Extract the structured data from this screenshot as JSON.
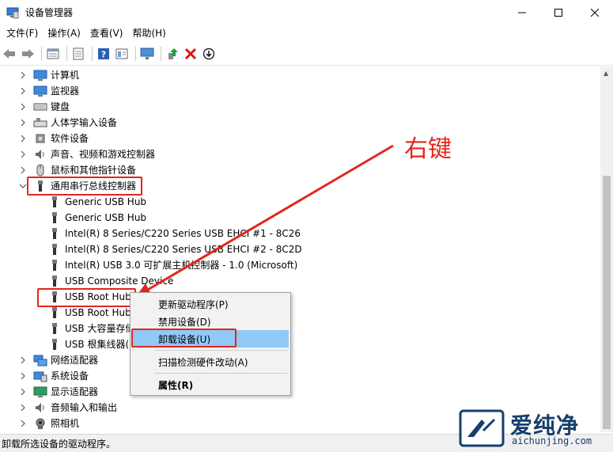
{
  "window": {
    "title": "设备管理器",
    "controls": [
      "minimize",
      "maximize",
      "close"
    ]
  },
  "menu": [
    {
      "label": "文件(F)"
    },
    {
      "label": "操作(A)"
    },
    {
      "label": "查看(V)"
    },
    {
      "label": "帮助(H)"
    }
  ],
  "toolbar": {
    "buttons": [
      "back-arrow-icon",
      "forward-arrow-icon",
      "properties-sheet-icon",
      "device-list-icon",
      "help-icon",
      "action-view-icon",
      "monitor-scan-icon",
      "update-driver-icon",
      "uninstall-x-icon",
      "download-circle-icon"
    ]
  },
  "tree": {
    "categories_top": [
      {
        "label": "计算机",
        "icon": "computer-icon"
      },
      {
        "label": "监视器",
        "icon": "monitor-icon"
      },
      {
        "label": "键盘",
        "icon": "keyboard-icon"
      },
      {
        "label": "人体学输入设备",
        "icon": "hid-icon"
      },
      {
        "label": "软件设备",
        "icon": "software-device-icon"
      },
      {
        "label": "声音、视频和游戏控制器",
        "icon": "sound-icon"
      },
      {
        "label": "鼠标和其他指针设备",
        "icon": "mouse-icon"
      }
    ],
    "usb_category": {
      "label": "通用串行总线控制器",
      "icon": "usb-plug-icon",
      "expanded": true
    },
    "usb_children": [
      {
        "label": "Generic USB Hub"
      },
      {
        "label": "Generic USB Hub"
      },
      {
        "label": "Intel(R) 8 Series/C220 Series USB EHCI #1 - 8C26"
      },
      {
        "label": "Intel(R) 8 Series/C220 Series USB EHCI #2 - 8C2D"
      },
      {
        "label": "Intel(R) USB 3.0 可扩展主机控制器 - 1.0 (Microsoft)"
      },
      {
        "label": "USB Composite Device"
      },
      {
        "label": "USB Root Hub"
      },
      {
        "label": "USB Root Hub"
      },
      {
        "label": "USB 大容量存储设备"
      },
      {
        "label": "USB 根集线器(USB 3.0)"
      }
    ],
    "categories_bottom": [
      {
        "label": "网络适配器",
        "icon": "network-adapter-icon"
      },
      {
        "label": "系统设备",
        "icon": "system-device-icon"
      },
      {
        "label": "显示适配器",
        "icon": "display-adapter-icon"
      },
      {
        "label": "音频输入和输出",
        "icon": "audio-io-icon"
      },
      {
        "label": "照相机",
        "icon": "camera-icon"
      }
    ]
  },
  "context_menu": {
    "items": [
      {
        "label": "更新驱动程序(P)"
      },
      {
        "label": "禁用设备(D)"
      },
      {
        "label": "卸载设备(U)",
        "highlighted": true
      },
      {
        "label": "扫描检测硬件改动(A)"
      },
      {
        "label": "属性(R)",
        "bold": true
      }
    ]
  },
  "annotation": {
    "callout": "右键",
    "color": "#e3261c"
  },
  "statusbar": {
    "text": "卸载所选设备的驱动程序。"
  },
  "watermark": {
    "brand": "爱纯净",
    "url": "aichunjing.com"
  },
  "colors": {
    "highlight": "#91c9f7",
    "annotation_red": "#e3261c",
    "brand_blue": "#163e6c"
  }
}
